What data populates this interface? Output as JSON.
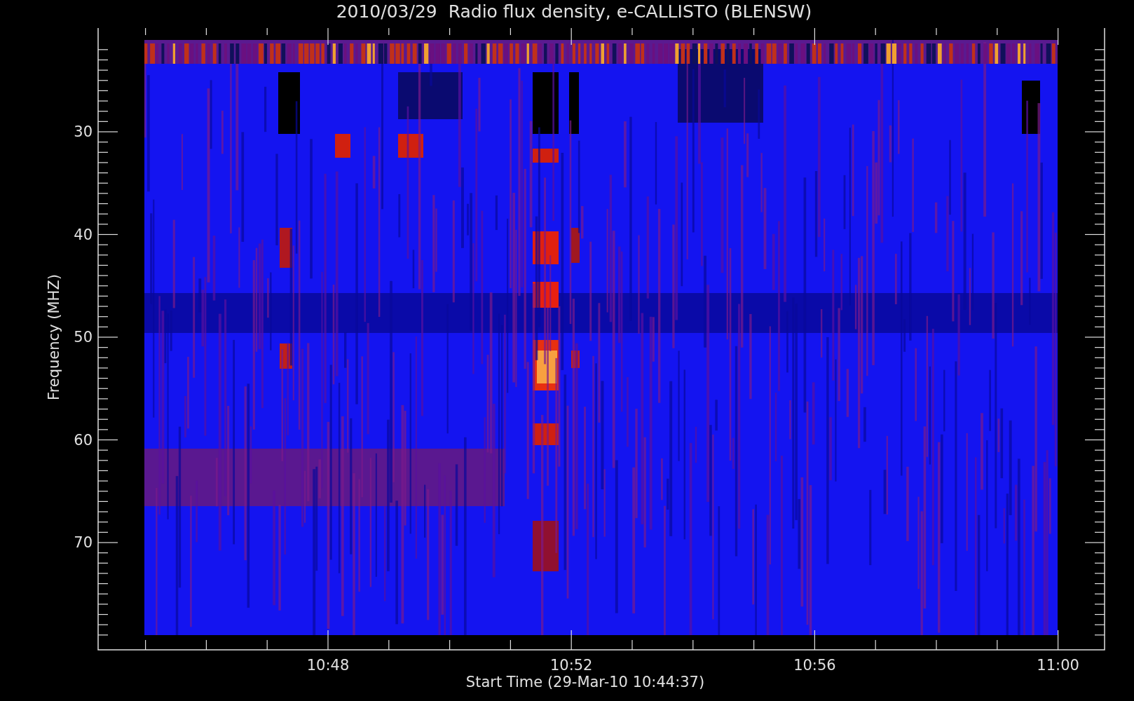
{
  "title": "2010/03/29  Radio flux density, e-CALLISTO (BLENSW)",
  "y_axis": {
    "label": "Frequency (MHZ)",
    "ticks": [
      "30",
      "40",
      "50",
      "60",
      "70"
    ]
  },
  "x_axis": {
    "label": "Start Time (29-Mar-10 10:44:37)",
    "ticks": [
      "10:48",
      "10:52",
      "10:56",
      "11:00"
    ]
  }
}
